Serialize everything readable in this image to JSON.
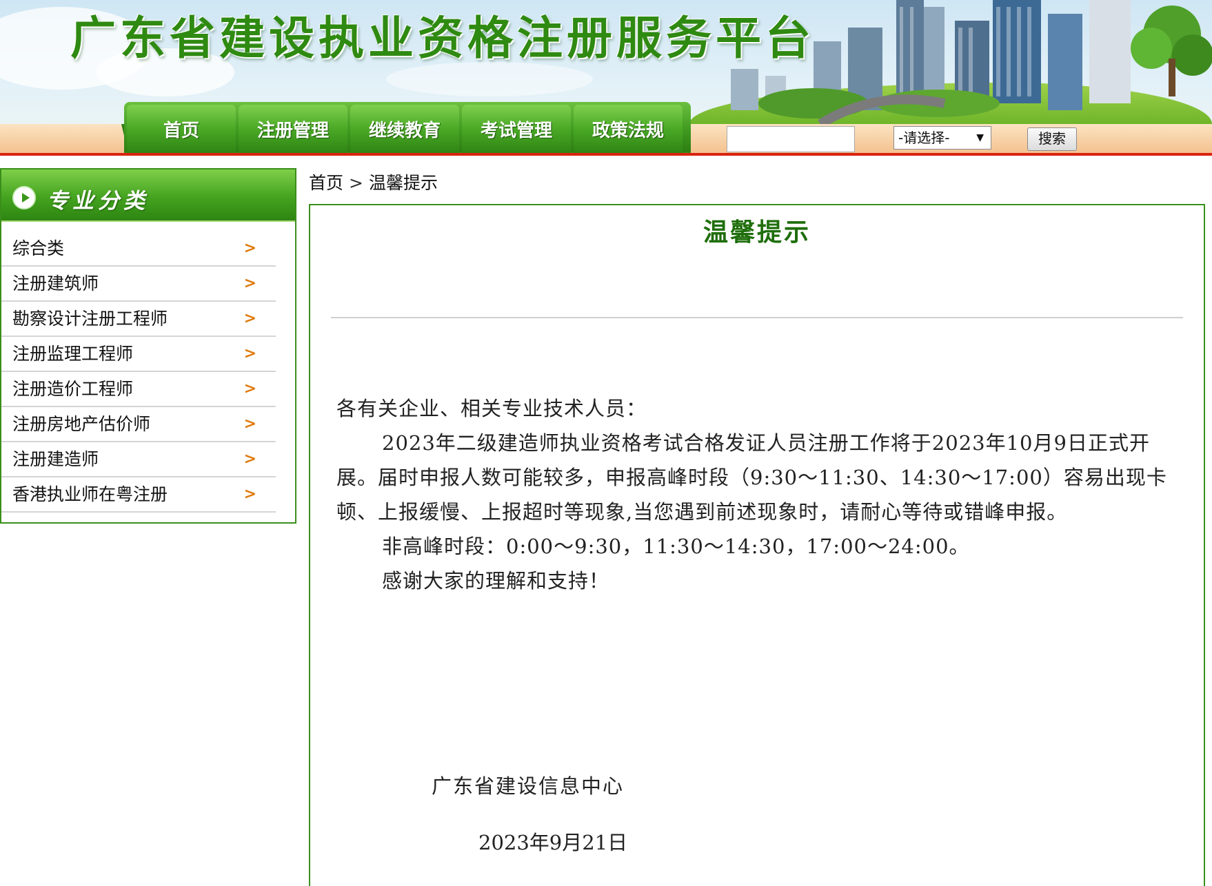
{
  "header": {
    "site_title": "广东省建设执业资格注册服务平台",
    "nav": [
      "首页",
      "注册管理",
      "继续教育",
      "考试管理",
      "政策法规"
    ],
    "search": {
      "input_value": "",
      "select_value": "-请选择-",
      "button_label": "搜索"
    }
  },
  "sidebar": {
    "title": "专业分类",
    "items": [
      "综合类",
      "注册建筑师",
      "勘察设计注册工程师",
      "注册监理工程师",
      "注册造价工程师",
      "注册房地产估价师",
      "注册建造师",
      "香港执业师在粤注册"
    ]
  },
  "breadcrumb": {
    "home": "首页",
    "sep": ">",
    "current": "温馨提示"
  },
  "article": {
    "title": "温馨提示",
    "greeting": "各有关企业、相关专业技术人员：",
    "para1": "2023年二级建造师执业资格考试合格发证人员注册工作将于2023年10月9日正式开展。届时申报人数可能较多，申报高峰时段（9:30～11:30、14:30～17:00）容易出现卡顿、上报缓慢、上报超时等现象,当您遇到前述现象时，请耐心等待或错峰申报。",
    "para2": "非高峰时段：0:00～9:30，11:30～14:30，17:00～24:00。",
    "para3": "感谢大家的理解和支持！",
    "sign_org": "广东省建设信息中心",
    "sign_date": "2023年9月21日"
  },
  "colors": {
    "brand_green": "#3a8f1b",
    "title_green": "#2f8a12",
    "accent_red": "#d9230f",
    "chevron_orange": "#e07a0c"
  },
  "icons": {
    "sidebar_header": "play-circle-icon",
    "sidebar_item": "chevron-right-icon",
    "select": "triangle-down-icon"
  }
}
